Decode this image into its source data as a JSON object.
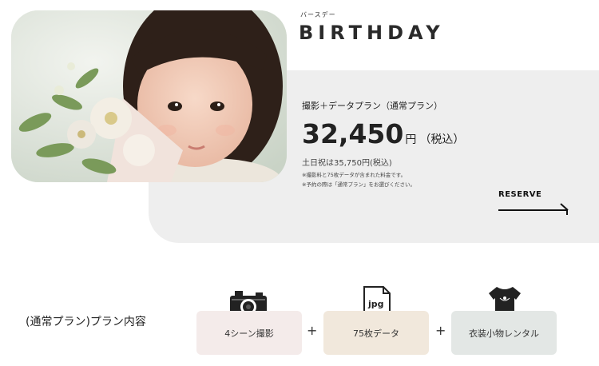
{
  "hero": {
    "kana": "バースデー",
    "title": "BIRTHDAY"
  },
  "plan": {
    "name": "撮影＋データプラン（通常プラン）",
    "price": "32,450",
    "yen": "円",
    "tax": "（税込）",
    "weekend": "土日祝は35,750円(税込)",
    "note1": "※撮影料と75枚データが含まれた料金です。",
    "note2": "※予約の際は「通常プラン」をお選びください。",
    "reserve_label": "RESERVE"
  },
  "contents": {
    "label": "(通常プラン)プラン内容",
    "jpg_label": "jpg",
    "items": [
      {
        "label": "4シーン撮影",
        "icon": "camera-icon"
      },
      {
        "label": "75枚データ",
        "icon": "jpg-file-icon"
      },
      {
        "label": "衣装小物レンタル",
        "icon": "dress-icon"
      }
    ],
    "plus": "+"
  }
}
